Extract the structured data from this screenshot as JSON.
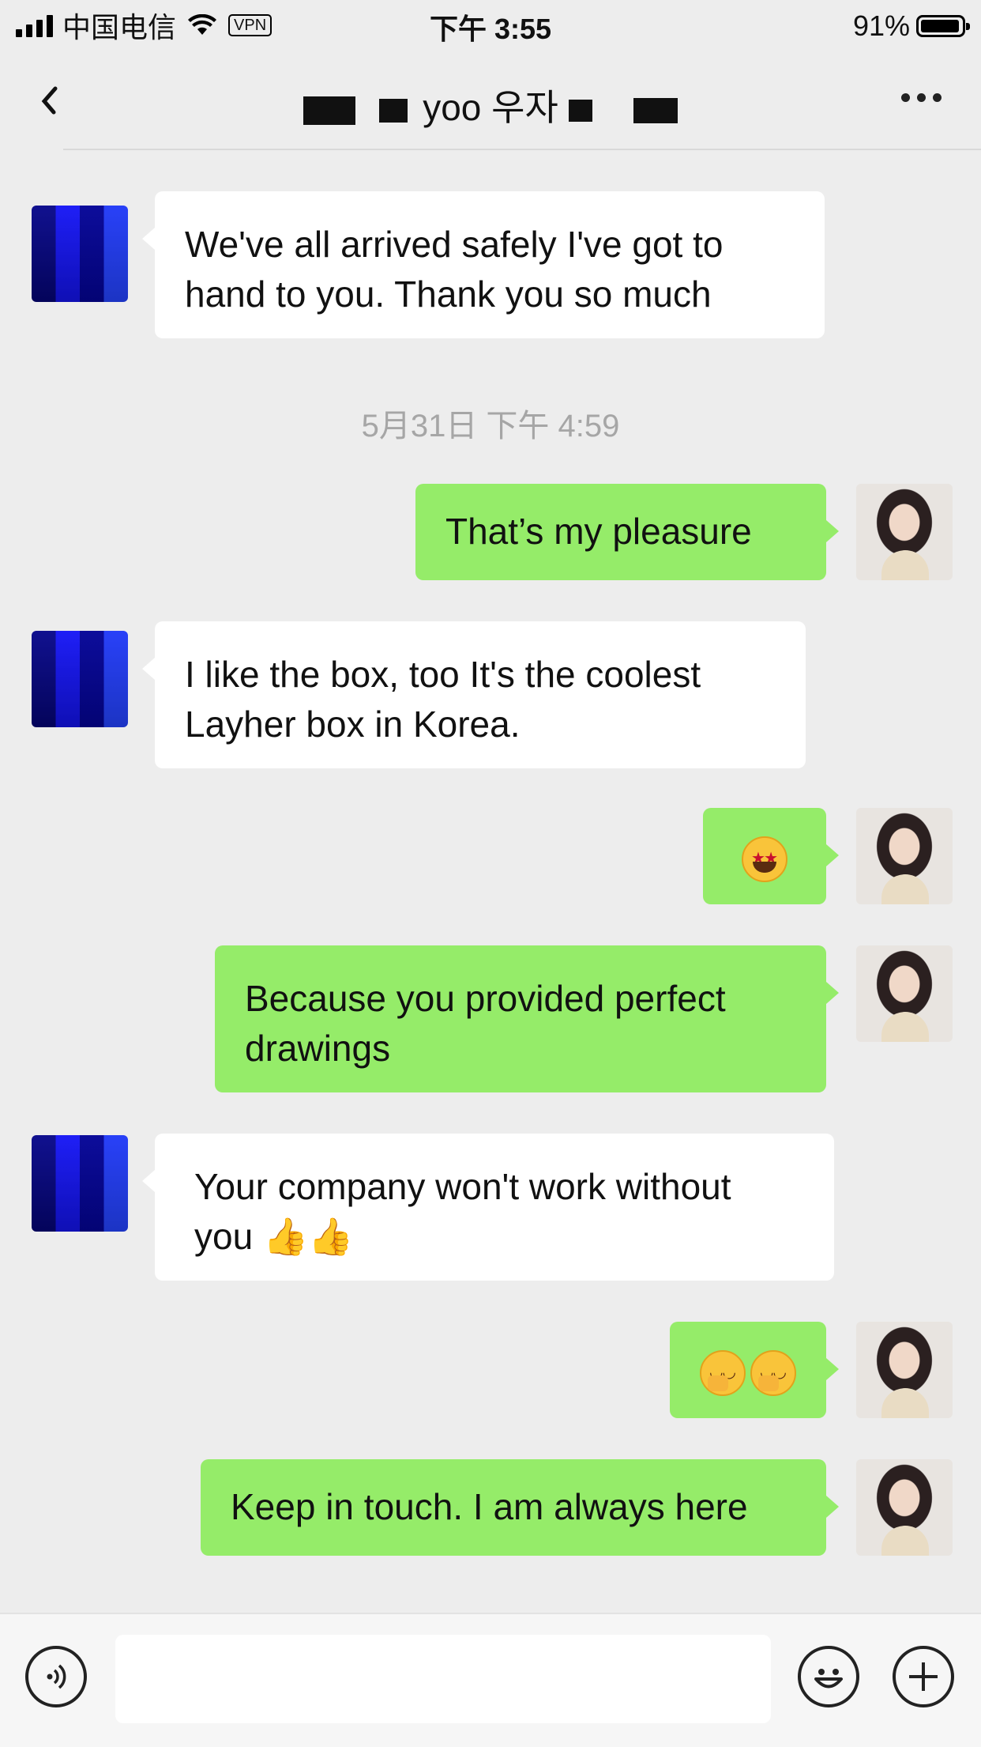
{
  "status_bar": {
    "carrier": "中国电信",
    "vpn_label": "VPN",
    "time": "下午 3:55",
    "battery_percent": "91%",
    "battery_level": 0.91
  },
  "nav": {
    "title_visible": "yoo 우자",
    "back_icon": "chevron-left-icon",
    "more_icon": "more-dots-icon"
  },
  "messages": [
    {
      "side": "left",
      "text_lines": [
        "We've all arrived safely I've got to",
        "hand to you. Thank you so much"
      ]
    },
    {
      "side": "right",
      "text_lines": [
        "That’s my pleasure"
      ]
    },
    {
      "side": "left",
      "text_lines": [
        "I like the box, too It's the coolest",
        "Layher box in Korea."
      ]
    },
    {
      "side": "right",
      "text_lines": [
        "🤩"
      ]
    },
    {
      "side": "right",
      "text_lines": [
        "Because you provided perfect",
        "drawings"
      ]
    },
    {
      "side": "left",
      "text_lines": [
        "Your company won't work without",
        "you 👍👍"
      ]
    },
    {
      "side": "right",
      "text_lines": [
        "🤭🤭"
      ]
    },
    {
      "side": "right",
      "text_lines": [
        "Keep in touch. I am always here"
      ]
    }
  ],
  "timestamp": "5月31日 下午 4:59",
  "bottom_bar": {
    "voice_icon": "voice-icon",
    "emoji_icon": "emoji-icon",
    "plus_icon": "plus-icon",
    "input_value": ""
  }
}
